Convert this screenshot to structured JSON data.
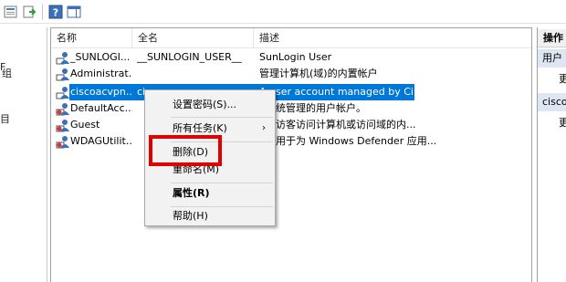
{
  "colors": {
    "selection": "#0078d7",
    "highlight_box": "#e00000",
    "menu_bg": "#f2f2f2"
  },
  "toolbar": {
    "icons": [
      "properties-icon",
      "export-list-icon",
      "help-icon",
      "show-hide-action-pane-icon"
    ]
  },
  "tree": {
    "fragments": [
      "F",
      "组",
      "目"
    ]
  },
  "list": {
    "columns": [
      "名称",
      "全名",
      "描述"
    ],
    "rows": [
      {
        "name": "_SUNLOGI...",
        "full_name": "__SUNLOGIN_USER__",
        "description": "SunLogin User"
      },
      {
        "name": "Administrat...",
        "full_name": "",
        "description": "管理计算机(域)的内置帐户"
      },
      {
        "name": "ciscoacvpn...",
        "full_name": "ciscoacvpnuser",
        "description": "A user account managed by Ci..."
      },
      {
        "name": "DefaultAcc...",
        "full_name": "",
        "description": "统管理的用户帐户。"
      },
      {
        "name": "Guest",
        "full_name": "",
        "description": "访客访问计算机或访问域的内..."
      },
      {
        "name": "WDAGUtilit...",
        "full_name": "",
        "description": "用于为 Windows Defender 应用..."
      }
    ]
  },
  "actions": {
    "header": "操作",
    "section1": "用户",
    "section2": "cisco",
    "item1": "更",
    "item2": "更"
  },
  "context_menu": {
    "set_password": "设置密码(S)...",
    "all_tasks": "所有任务(K)",
    "delete": "删除(D)",
    "rename": "重命名(M)",
    "properties": "属性(R)",
    "help": "帮助(H)",
    "submenu_arrow": "›"
  }
}
